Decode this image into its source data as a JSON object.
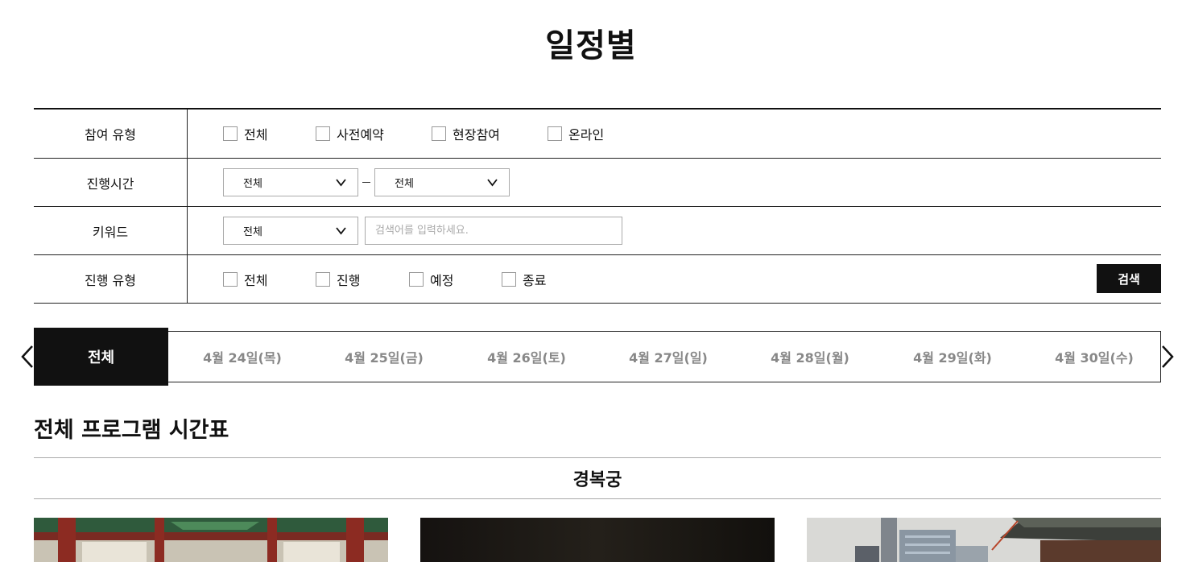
{
  "page": {
    "title": "일정별"
  },
  "filters": {
    "participation": {
      "label": "참여 유형",
      "options": [
        "전체",
        "사전예약",
        "현장참여",
        "온라인"
      ]
    },
    "time": {
      "label": "진행시간",
      "start_value": "전체",
      "end_value": "전체"
    },
    "keyword": {
      "label": "키워드",
      "select_value": "전체",
      "placeholder": "검색어를 입력하세요."
    },
    "status": {
      "label": "진행 유형",
      "options": [
        "전체",
        "진행",
        "예정",
        "종료"
      ]
    },
    "search_label": "검색"
  },
  "date_nav": {
    "all_label": "전체",
    "dates": [
      "4월 24일(목)",
      "4월 25일(금)",
      "4월 26일(토)",
      "4월 27일(일)",
      "4월 28일(월)",
      "4월 29일(화)",
      "4월 30일(수)"
    ]
  },
  "schedule": {
    "section_title": "전체 프로그램 시간표",
    "venue": "경복궁"
  },
  "icons": [
    "chevron-left-icon",
    "chevron-right-icon",
    "chevron-down-icon"
  ]
}
